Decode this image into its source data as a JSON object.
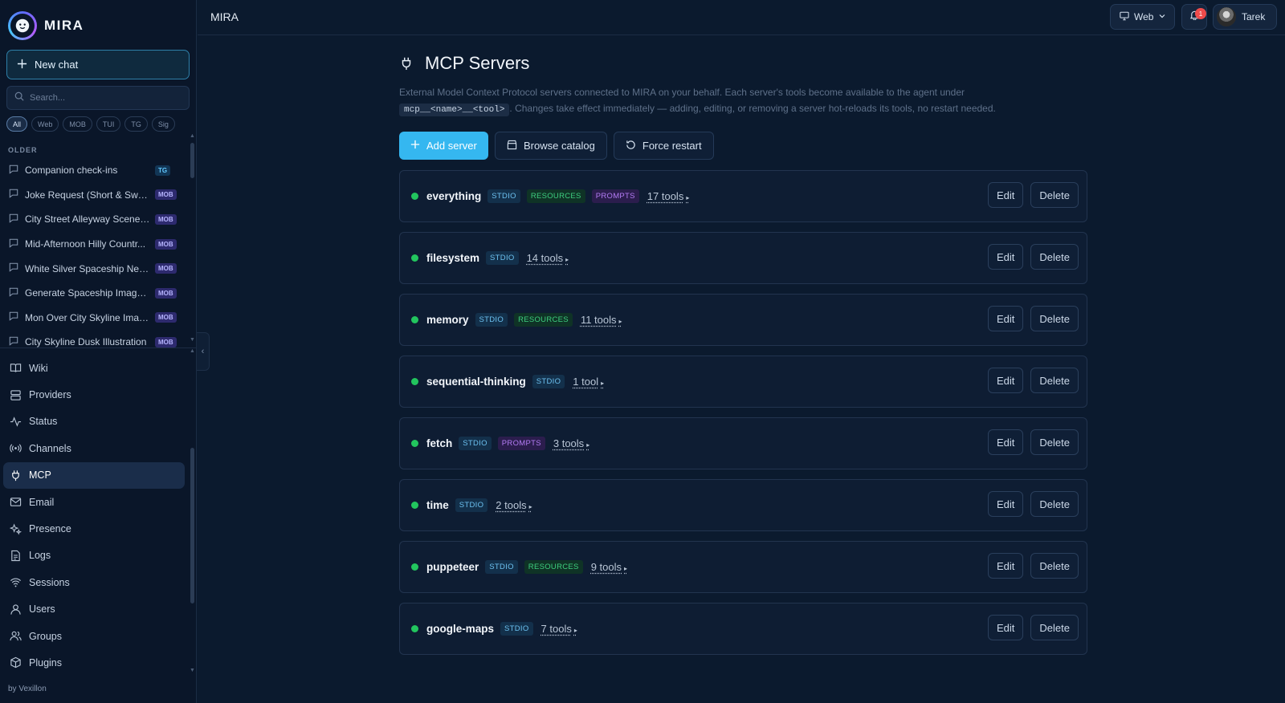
{
  "app": {
    "name": "MIRA",
    "credit": "by Vexillon"
  },
  "sidebar": {
    "new_chat_label": "New chat",
    "search_placeholder": "Search...",
    "filters": [
      "All",
      "Web",
      "MOB",
      "TUI",
      "TG",
      "Sig"
    ],
    "section_label": "OLDER",
    "chats": [
      {
        "title": "Companion check-ins",
        "badge": "TG"
      },
      {
        "title": "Joke Request (Short & Sweet)",
        "badge": "MOB"
      },
      {
        "title": "City Street Alleyway Scene (...",
        "badge": "MOB"
      },
      {
        "title": "Mid-Afternoon Hilly Countr...",
        "badge": "MOB"
      },
      {
        "title": "White Silver Spaceship Near...",
        "badge": "MOB"
      },
      {
        "title": "Generate Spaceship Image i...",
        "badge": "MOB"
      },
      {
        "title": "Mon Over City Skyline Imag...",
        "badge": "MOB"
      },
      {
        "title": "City Skyline Dusk Illustration",
        "badge": "MOB"
      }
    ],
    "nav": [
      {
        "label": "Wiki",
        "icon": "book-icon"
      },
      {
        "label": "Providers",
        "icon": "server-icon"
      },
      {
        "label": "Status",
        "icon": "activity-icon"
      },
      {
        "label": "Channels",
        "icon": "broadcast-icon"
      },
      {
        "label": "MCP",
        "icon": "plug-icon",
        "active": true
      },
      {
        "label": "Email",
        "icon": "mail-icon"
      },
      {
        "label": "Presence",
        "icon": "sparkles-icon"
      },
      {
        "label": "Logs",
        "icon": "file-text-icon"
      },
      {
        "label": "Sessions",
        "icon": "wifi-icon"
      },
      {
        "label": "Users",
        "icon": "user-icon"
      },
      {
        "label": "Groups",
        "icon": "users-icon"
      },
      {
        "label": "Plugins",
        "icon": "package-icon"
      }
    ]
  },
  "topbar": {
    "title": "MIRA",
    "channel_label": "Web",
    "notification_count": "1",
    "user_name": "Tarek"
  },
  "page": {
    "title": "MCP Servers",
    "description_part1": "External Model Context Protocol servers connected to MIRA on your behalf. Each server's tools become available to the agent under",
    "description_code": "mcp__<name>__<tool>",
    "description_part2": ". Changes take effect immediately — adding, editing, or removing a server hot-reloads its tools, no restart needed.",
    "add_label": "Add server",
    "browse_label": "Browse catalog",
    "restart_label": "Force restart",
    "edit_label": "Edit",
    "delete_label": "Delete",
    "servers": [
      {
        "name": "everything",
        "tags": [
          "STDIO",
          "RESOURCES",
          "PROMPTS"
        ],
        "tools": "17 tools",
        "status": "connected"
      },
      {
        "name": "filesystem",
        "tags": [
          "STDIO"
        ],
        "tools": "14 tools",
        "status": "connected"
      },
      {
        "name": "memory",
        "tags": [
          "STDIO",
          "RESOURCES"
        ],
        "tools": "11 tools",
        "status": "connected"
      },
      {
        "name": "sequential-thinking",
        "tags": [
          "STDIO"
        ],
        "tools": "1 tool",
        "status": "connected"
      },
      {
        "name": "fetch",
        "tags": [
          "STDIO",
          "PROMPTS"
        ],
        "tools": "3 tools",
        "status": "connected"
      },
      {
        "name": "time",
        "tags": [
          "STDIO"
        ],
        "tools": "2 tools",
        "status": "connected"
      },
      {
        "name": "puppeteer",
        "tags": [
          "STDIO",
          "RESOURCES"
        ],
        "tools": "9 tools",
        "status": "connected"
      },
      {
        "name": "google-maps",
        "tags": [
          "STDIO"
        ],
        "tools": "7 tools",
        "status": "connected"
      }
    ]
  },
  "colors": {
    "accent": "#35b7f0",
    "status_ok": "#22c55e",
    "bg": "#0b1a2e",
    "sidebar_bg": "#0a1629"
  }
}
